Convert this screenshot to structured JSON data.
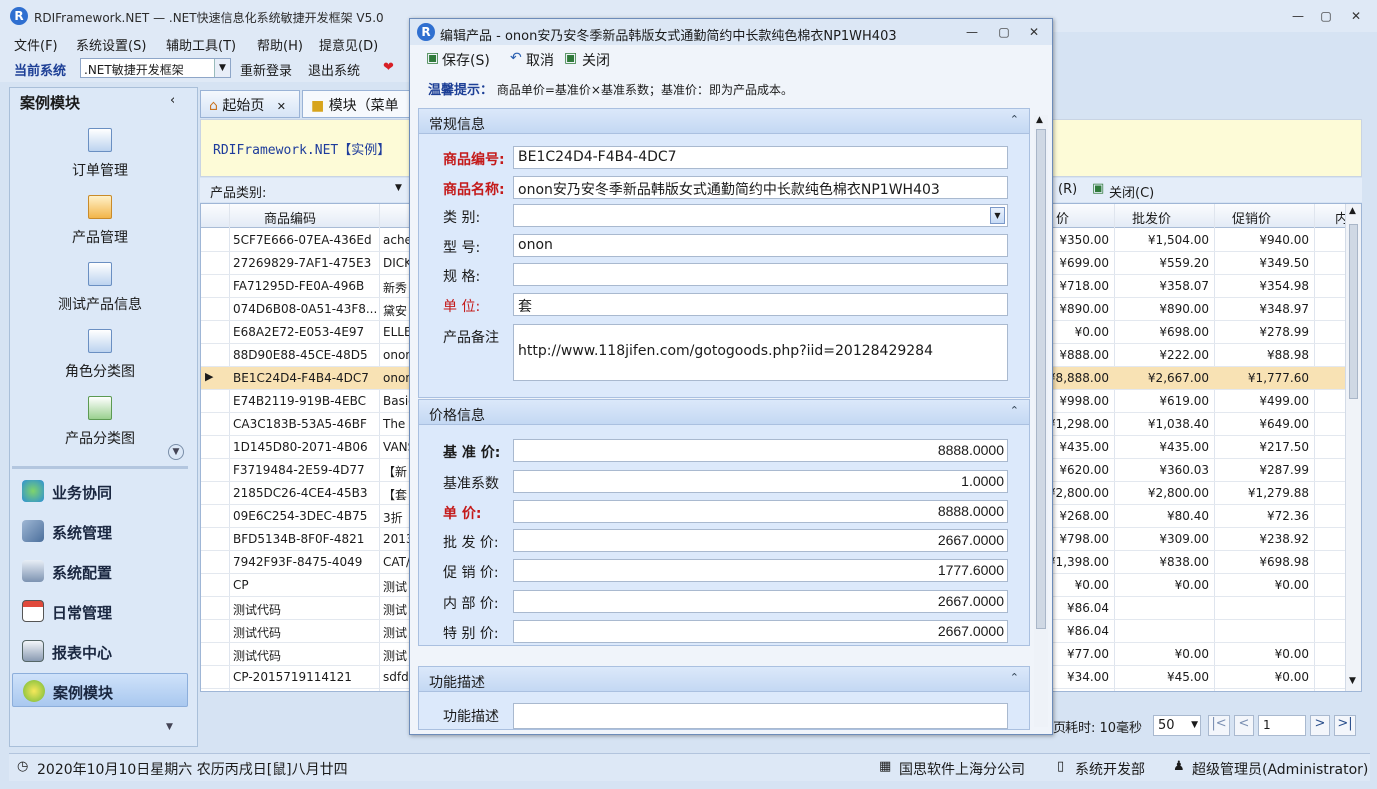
{
  "app": {
    "title": "RDIFramework.NET — .NET快速信息化系统敏捷开发框架 V5.0",
    "menu": [
      "文件(F)",
      "系统设置(S)",
      "辅助工具(T)",
      "帮助(H)",
      "提意见(D)"
    ],
    "current_system_label": "当前系统",
    "current_system_value": ".NET敏捷开发框架",
    "relogin": "重新登录",
    "exit": "退出系统"
  },
  "left_panel": {
    "header": "案例模块",
    "items": [
      "订单管理",
      "产品管理",
      "测试产品信息",
      "角色分类图",
      "产品分类图"
    ],
    "groups": [
      "业务协同",
      "系统管理",
      "系统配置",
      "日常管理",
      "报表中心",
      "案例模块"
    ]
  },
  "tabs": [
    "起始页",
    "模块（菜单"
  ],
  "notice": "RDIFramework.NET【实例】",
  "filter": {
    "label": "产品类别:",
    "refresh_suffix": "(R)",
    "close": "关闭(C)"
  },
  "grid": {
    "columns": [
      "商品编码",
      "价",
      "批发价",
      "促销价",
      "内"
    ],
    "rows": [
      {
        "code": "5CF7E666-07EA-436Ed",
        "name": "ache",
        "price": "¥350.00",
        "wholesale": "¥1,504.00",
        "promo": "¥940.00"
      },
      {
        "code": "27269829-7AF1-475E3",
        "name": "DICK",
        "price": "¥699.00",
        "wholesale": "¥559.20",
        "promo": "¥349.50"
      },
      {
        "code": "FA71295D-FE0A-496B",
        "name": "新秀",
        "price": "¥718.00",
        "wholesale": "¥358.07",
        "promo": "¥354.98"
      },
      {
        "code": "074D6B08-0A51-43F8...",
        "name": "黛安",
        "price": "¥890.00",
        "wholesale": "¥890.00",
        "promo": "¥348.97"
      },
      {
        "code": "E68A2E72-E053-4E97",
        "name": "ELLE",
        "price": "¥0.00",
        "wholesale": "¥698.00",
        "promo": "¥278.99"
      },
      {
        "code": "88D90E88-45CE-48D5",
        "name": "onon",
        "price": "¥888.00",
        "wholesale": "¥222.00",
        "promo": "¥88.98"
      },
      {
        "code": "BE1C24D4-F4B4-4DC7",
        "name": "onon",
        "price": "¥8,888.00",
        "wholesale": "¥2,667.00",
        "promo": "¥1,777.60"
      },
      {
        "code": "E74B2119-919B-4EBC",
        "name": "Basic",
        "price": "¥998.00",
        "wholesale": "¥619.00",
        "promo": "¥499.00"
      },
      {
        "code": "CA3C183B-53A5-46BF",
        "name": "The",
        "price": "¥1,298.00",
        "wholesale": "¥1,038.40",
        "promo": "¥649.00"
      },
      {
        "code": "1D145D80-2071-4B06",
        "name": "VANS",
        "price": "¥435.00",
        "wholesale": "¥435.00",
        "promo": "¥217.50"
      },
      {
        "code": "F3719484-2E59-4D77",
        "name": "【新",
        "price": "¥620.00",
        "wholesale": "¥360.03",
        "promo": "¥287.99"
      },
      {
        "code": "2185DC26-4CE4-45B3",
        "name": "【套",
        "price": "¥2,800.00",
        "wholesale": "¥2,800.00",
        "promo": "¥1,279.88"
      },
      {
        "code": "09E6C254-3DEC-4B75",
        "name": "3折",
        "price": "¥268.00",
        "wholesale": "¥80.40",
        "promo": "¥72.36"
      },
      {
        "code": "BFD5134B-8F0F-4821",
        "name": "2013",
        "price": "¥798.00",
        "wholesale": "¥309.00",
        "promo": "¥238.92"
      },
      {
        "code": "7942F93F-8475-4049",
        "name": "CAT/",
        "price": "¥1,398.00",
        "wholesale": "¥838.00",
        "promo": "¥698.98"
      },
      {
        "code": "CP",
        "name": "测试",
        "price": "¥0.00",
        "wholesale": "¥0.00",
        "promo": "¥0.00"
      },
      {
        "code": "测试代码",
        "name": "测试",
        "price": "¥86.04",
        "wholesale": "",
        "promo": ""
      },
      {
        "code": "测试代码",
        "name": "测试",
        "price": "¥86.04",
        "wholesale": "",
        "promo": ""
      },
      {
        "code": "测试代码",
        "name": "测试",
        "price": "¥77.00",
        "wholesale": "¥0.00",
        "promo": "¥0.00"
      },
      {
        "code": "CP-2015719114121",
        "name": "sdfd",
        "price": "¥34.00",
        "wholesale": "¥45.00",
        "promo": "¥0.00"
      }
    ]
  },
  "pager": {
    "elapsed_label": "耗时: 10毫秒",
    "page_size": "50",
    "page": "1"
  },
  "status": {
    "date": "2020年10月10日星期六 农历丙戌日[鼠]八月廿四",
    "company": "国思软件上海分公司",
    "dept": "系统开发部",
    "user": "超级管理员(Administrator)"
  },
  "dialog": {
    "title": "编辑产品 - onon安乃安冬季新品韩版女式通勤简约中长款纯色棉衣NP1WH403",
    "toolbar": {
      "save": "保存(S)",
      "cancel": "取消",
      "close": "关闭"
    },
    "hint_label": "温馨提示：",
    "hint_text": "商品单价=基准价×基准系数；基准价：即为产品成本。",
    "section_general": "常规信息",
    "section_price": "价格信息",
    "section_func": "功能描述",
    "fields": {
      "code_label": "商品编号:",
      "code": "BE1C24D4-F4B4-4DC7",
      "name_label": "商品名称:",
      "name": "onon安乃安冬季新品韩版女式通勤简约中长款纯色棉衣NP1WH403",
      "category_label": "类    别:",
      "category": "",
      "model_label": "型    号:",
      "model": "onon",
      "spec_label": "规    格:",
      "spec": "",
      "unit_label": "单    位:",
      "unit": "套",
      "remark_label": "产品备注",
      "remark": "http://www.118jifen.com/gotogoods.php?iid=20128429284"
    },
    "prices": {
      "base_label": "基 准 价:",
      "base": "8888.0000",
      "coef_label": "基准系数",
      "coef": "1.0000",
      "unit_label": "单    价:",
      "unit": "8888.0000",
      "wholesale_label": "批 发 价:",
      "wholesale": "2667.0000",
      "promo_label": "促 销 价:",
      "promo": "1777.6000",
      "internal_label": "内 部 价:",
      "internal": "2667.0000",
      "special_label": "特 别 价:",
      "special": "2667.0000"
    },
    "func_label": "功能描述"
  }
}
